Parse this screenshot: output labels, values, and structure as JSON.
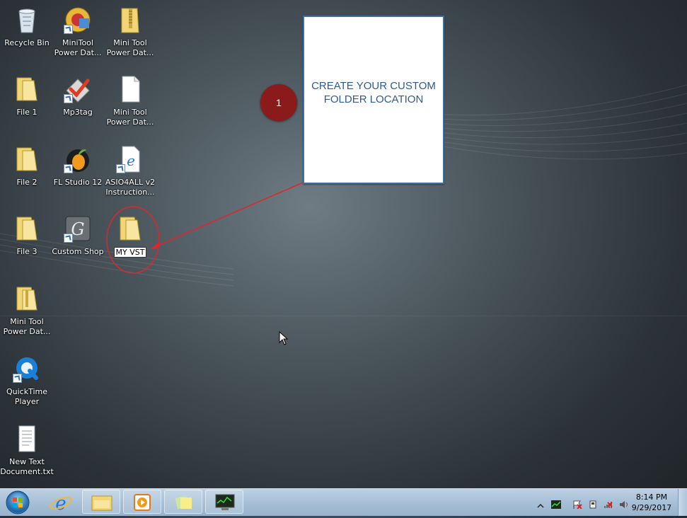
{
  "desktop": {
    "icons": [
      {
        "label": "Recycle Bin"
      },
      {
        "label": "MiniTool Power Dat..."
      },
      {
        "label": "Mini Tool Power Dat..."
      },
      {
        "label": "File 1"
      },
      {
        "label": "Mp3tag"
      },
      {
        "label": "Mini Tool Power Dat..."
      },
      {
        "label": "File 2"
      },
      {
        "label": "FL Studio 12"
      },
      {
        "label": "ASIO4ALL v2 Instruction..."
      },
      {
        "label": "File 3"
      },
      {
        "label": "Custom Shop"
      },
      {
        "label": "MY VST"
      },
      {
        "label": "Mini Tool Power Dat..."
      },
      {
        "label": "QuickTime Player"
      },
      {
        "label": "New Text Document.txt"
      }
    ]
  },
  "callout": {
    "text": "CREATE YOUR CUSTOM FOLDER LOCATION",
    "step": "1"
  },
  "taskbar": {
    "time": "8:14 PM",
    "date": "9/29/2017"
  },
  "colors": {
    "callout_border": "#3a6ea5",
    "callout_text": "#2f5b8f",
    "step_badge": "#8b1a1a",
    "annotation_red": "#e0262a",
    "folder_yellow": "#f2d675"
  }
}
